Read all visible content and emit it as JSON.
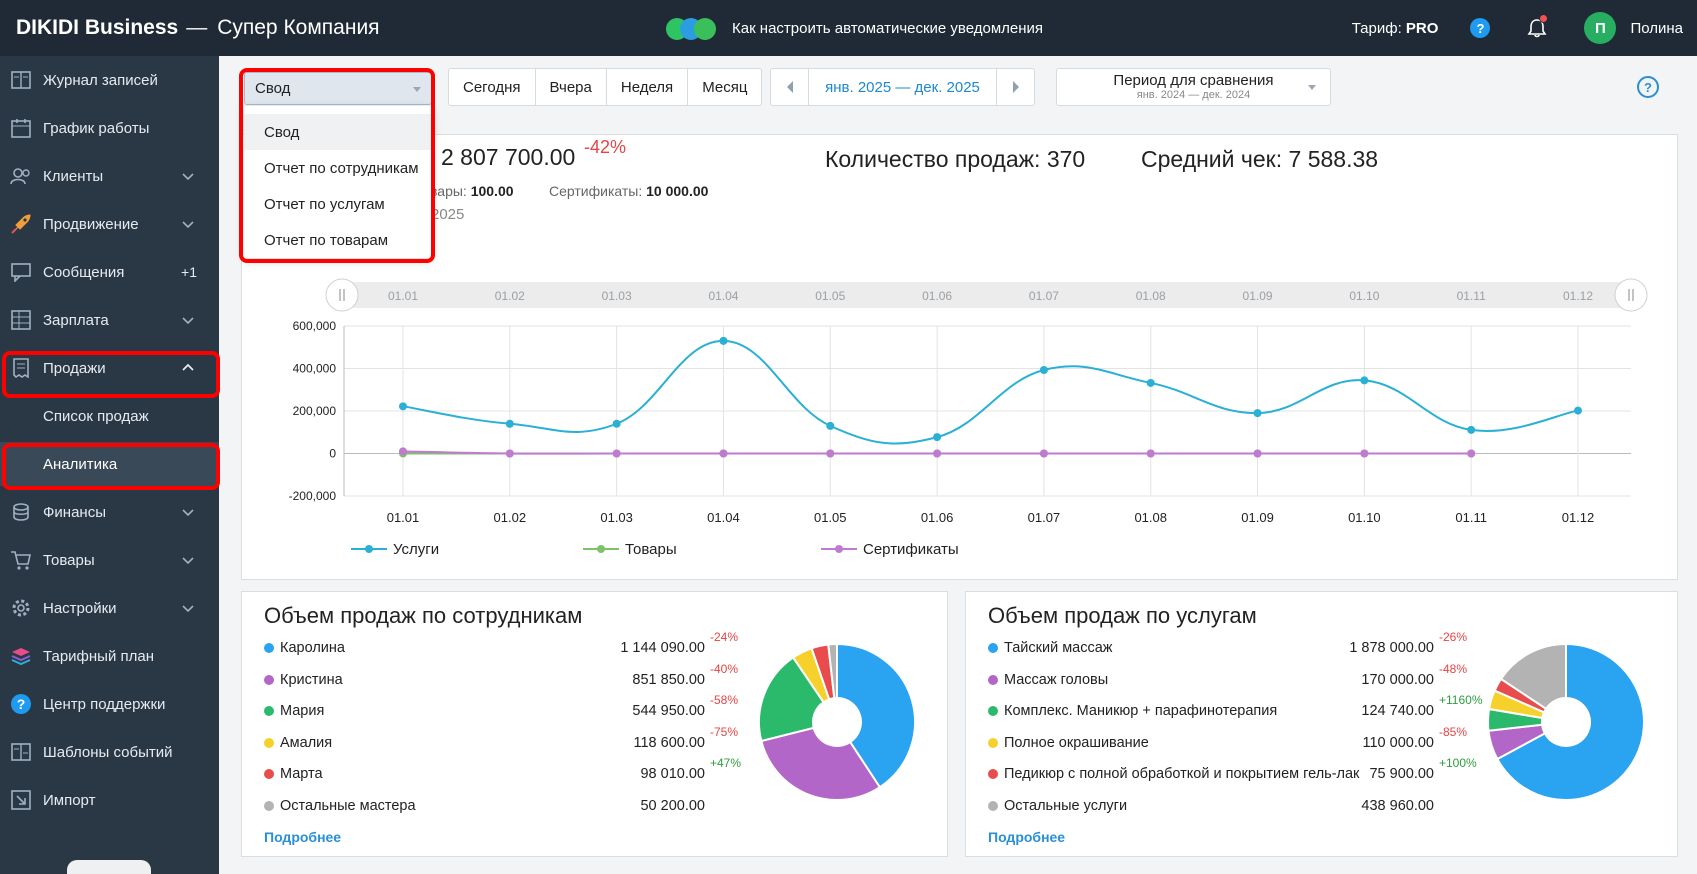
{
  "topbar": {
    "brand": "DIKIDI Business",
    "separator": "—",
    "company": "Супер Компания",
    "promo_text": "Как настроить автоматические уведомления",
    "tariff_label": "Тариф:",
    "tariff_value": "PRO",
    "help": "?",
    "avatar_letter": "П",
    "user_name": "Полина"
  },
  "sidebar": {
    "items": [
      {
        "label": "Журнал записей",
        "icon": "journal-icon"
      },
      {
        "label": "График работы",
        "icon": "calendar-icon"
      },
      {
        "label": "Клиенты",
        "icon": "clients-icon"
      },
      {
        "label": "Продвижение",
        "icon": "rocket-icon"
      },
      {
        "label": "Сообщения",
        "icon": "messages-icon",
        "badge": "+1"
      },
      {
        "label": "Зарплата",
        "icon": "salary-icon"
      },
      {
        "label": "Продажи",
        "icon": "receipt-icon"
      },
      {
        "label": "Финансы",
        "icon": "coins-icon"
      },
      {
        "label": "Товары",
        "icon": "cart-icon"
      },
      {
        "label": "Настройки",
        "icon": "gear-icon"
      },
      {
        "label": "Тарифный план",
        "icon": "layers-icon"
      },
      {
        "label": "Центр поддержки",
        "icon": "support-icon"
      },
      {
        "label": "Шаблоны событий",
        "icon": "templates-icon"
      },
      {
        "label": "Импорт",
        "icon": "import-icon"
      }
    ],
    "sub_items": [
      "Список продаж",
      "Аналитика"
    ]
  },
  "toolbar": {
    "report_select": "Свод",
    "quick_periods": [
      "Сегодня",
      "Вчера",
      "Неделя",
      "Месяц"
    ],
    "period": "янв. 2025 — дек. 2025",
    "compare_label": "Период для сравнения",
    "compare_period": "янв. 2024 — дек. 2024",
    "help": "?"
  },
  "dropdown": {
    "options": [
      "Свод",
      "Отчет по сотрудникам",
      "Отчет по услугам",
      "Отчет по товарам"
    ],
    "selected": "Свод"
  },
  "summary": {
    "total": "2 807 700.00",
    "total_delta": "-42%",
    "goods_label_partial": "вары:",
    "goods_value": "100.00",
    "certs_label": "Сертификаты:",
    "certs_value": "10 000.00",
    "period_partial": "2025",
    "sales_count": "Количество продаж: 370",
    "avg_check": "Средний чек: 7 588.38"
  },
  "chart_data": {
    "type": "line",
    "categories": [
      "01.01",
      "01.02",
      "01.03",
      "01.04",
      "01.05",
      "01.06",
      "01.07",
      "01.08",
      "01.09",
      "01.10",
      "01.11",
      "01.12"
    ],
    "series": [
      {
        "name": "Услуги",
        "color": "#2ab0d4",
        "values": [
          222000,
          140000,
          140000,
          530000,
          130000,
          77000,
          393000,
          332000,
          190000,
          344000,
          111000,
          202000
        ]
      },
      {
        "name": "Товары",
        "color": "#7cc26a",
        "values": [
          0,
          0,
          0,
          0,
          0,
          0,
          0,
          0,
          0,
          0,
          0,
          null
        ]
      },
      {
        "name": "Сертификаты",
        "color": "#c07ad0",
        "values": [
          10000,
          0,
          0,
          0,
          0,
          0,
          0,
          0,
          0,
          0,
          0,
          null
        ]
      }
    ],
    "y_ticks": [
      "600,000",
      "400,000",
      "200,000",
      "0",
      "-200,000"
    ],
    "ylim": [
      -200000,
      600000
    ],
    "grid": true,
    "legend": "bottom-left"
  },
  "employees_panel": {
    "title": "Объем продаж по сотрудникам",
    "rows": [
      {
        "name": "Каролина",
        "value": "1 144 090.00",
        "delta": "-24%",
        "color": "#2aa3f0"
      },
      {
        "name": "Кристина",
        "value": "851 850.00",
        "delta": "-40%",
        "color": "#b266c7"
      },
      {
        "name": "Мария",
        "value": "544 950.00",
        "delta": "-58%",
        "color": "#2bba6c"
      },
      {
        "name": "Амалия",
        "value": "118 600.00",
        "delta": "-75%",
        "color": "#f6d12b"
      },
      {
        "name": "Марта",
        "value": "98 010.00",
        "delta": "+47%",
        "color": "#e84c4c"
      },
      {
        "name": "Остальные мастера",
        "value": "50 200.00",
        "delta": "",
        "color": "#b3b3b3"
      }
    ],
    "pie_values": [
      1144090,
      851850,
      544950,
      118600,
      98010,
      50200
    ],
    "more": "Подробнее"
  },
  "services_panel": {
    "title": "Объем продаж по услугам",
    "rows": [
      {
        "name": "Тайский массаж",
        "value": "1 878 000.00",
        "delta": "-26%",
        "color": "#2aa3f0"
      },
      {
        "name": "Массаж головы",
        "value": "170 000.00",
        "delta": "-48%",
        "color": "#b266c7"
      },
      {
        "name": "Комплекс. Маникюр + парафинотерапия",
        "value": "124 740.00",
        "delta": "+1160%",
        "color": "#2bba6c"
      },
      {
        "name": "Полное окрашивание",
        "value": "110 000.00",
        "delta": "-85%",
        "color": "#f6d12b"
      },
      {
        "name": "Педикюр с полной обработкой и покрытием гель-лак",
        "value": "75 900.00",
        "delta": "+100%",
        "color": "#e84c4c"
      },
      {
        "name": "Остальные услуги",
        "value": "438 960.00",
        "delta": "",
        "color": "#b3b3b3"
      }
    ],
    "pie_values": [
      1878000,
      170000,
      124740,
      110000,
      75900,
      438960
    ],
    "more": "Подробнее"
  },
  "colors": {
    "sidebar_bg": "#2a3744",
    "topbar_bg": "#1f2a36",
    "accent": "#2a8fd6",
    "highlight": "#ff0000",
    "negative": "#e54545",
    "positive": "#2e9e3e"
  }
}
